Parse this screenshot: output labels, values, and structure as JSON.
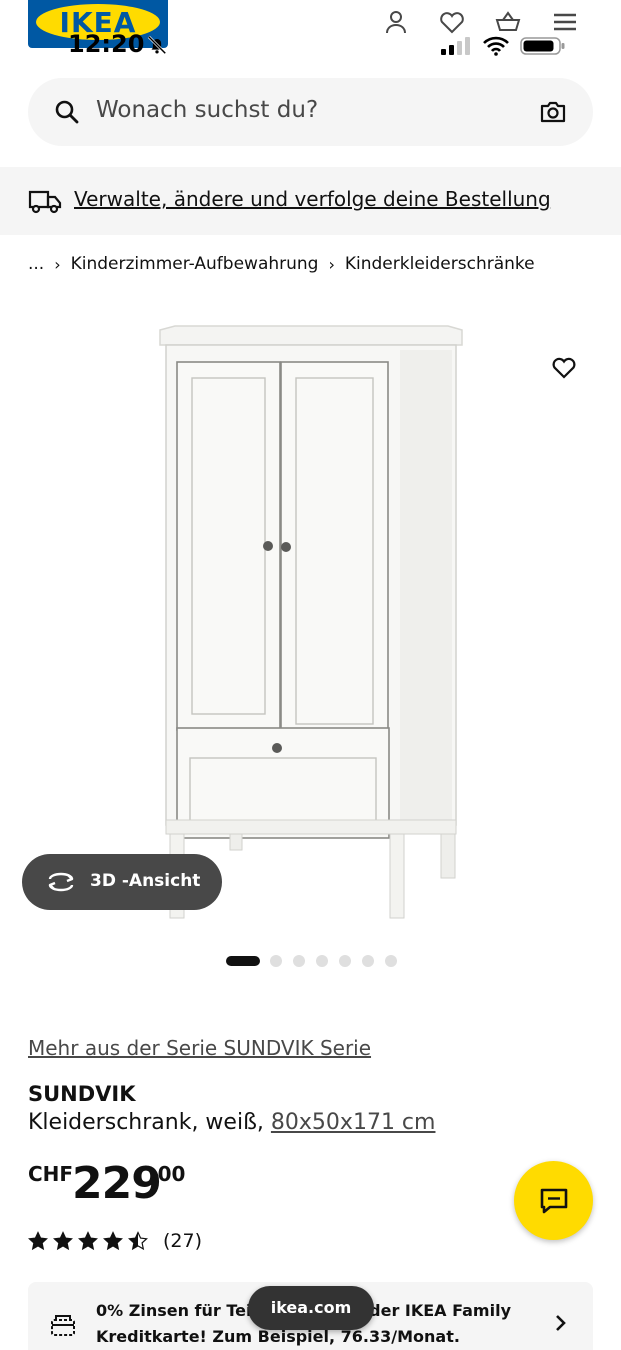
{
  "status_bar": {
    "time": "12:20"
  },
  "header": {
    "logo_text": "IKEA"
  },
  "search": {
    "placeholder": "Wonach suchst du?"
  },
  "banner": {
    "link_text": "Verwalte, ändere und verfolge deine Bestellung"
  },
  "breadcrumb": {
    "ellipsis": "...",
    "items": [
      "Kinderzimmer-Aufbewahrung",
      "Kinderkleiderschränke"
    ]
  },
  "gallery": {
    "view3d_label": "3D -Ansicht",
    "image_count": 7,
    "active_index": 0
  },
  "product": {
    "series_link": "Mehr aus der Serie SUNDVIK Serie",
    "name": "SUNDVIK",
    "description": "Kleiderschrank, weiß,",
    "dimensions": "80x50x171 cm",
    "price_currency": "CHF",
    "price_integer": "229",
    "price_decimal": ".00",
    "rating": 4.5,
    "review_count": "(27)"
  },
  "finance": {
    "text": "0% Zinsen für Teilzahlung mit der IKEA Family Kreditkarte! Zum Beispiel, 76.33/Monat."
  },
  "browser": {
    "url": "ikea.com"
  },
  "colors": {
    "ikea_blue": "#0058a3",
    "ikea_yellow": "#ffdb00",
    "dark": "#111111",
    "grey_bg": "#f5f5f5"
  }
}
